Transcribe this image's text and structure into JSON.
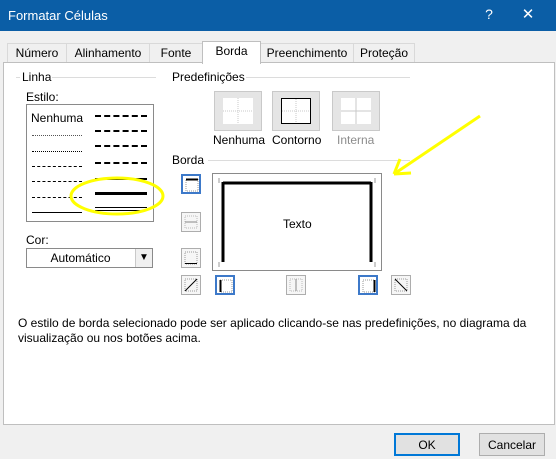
{
  "window": {
    "title": "Formatar Células",
    "help_glyph": "?",
    "close_glyph": "✕"
  },
  "tabs": [
    {
      "label": "Número",
      "active": false
    },
    {
      "label": "Alinhamento",
      "active": false
    },
    {
      "label": "Fonte",
      "active": false
    },
    {
      "label": "Borda",
      "active": true
    },
    {
      "label": "Preenchimento",
      "active": false
    },
    {
      "label": "Proteção",
      "active": false
    }
  ],
  "line_section": {
    "title": "Linha",
    "style_label": "Estilo:",
    "none_label": "Nenhuma",
    "selected_style": "medium-solid",
    "color_label": "Cor:",
    "color_value": "Automático"
  },
  "presets": {
    "title": "Predefinições",
    "items": [
      {
        "label": "Nenhuma",
        "enabled": true
      },
      {
        "label": "Contorno",
        "enabled": true
      },
      {
        "label": "Interna",
        "enabled": false
      }
    ]
  },
  "border": {
    "title": "Borda",
    "preview_text": "Texto"
  },
  "description": "O estilo de borda selecionado pode ser aplicado clicando-se nas predefinições, no diagrama da visualização ou nos botões acima.",
  "buttons": {
    "ok": "OK",
    "cancel": "Cancelar"
  },
  "colors": {
    "title_bar": "#0b5ea6",
    "highlight": "#ffff00",
    "selected_border": "#3d79c9"
  }
}
